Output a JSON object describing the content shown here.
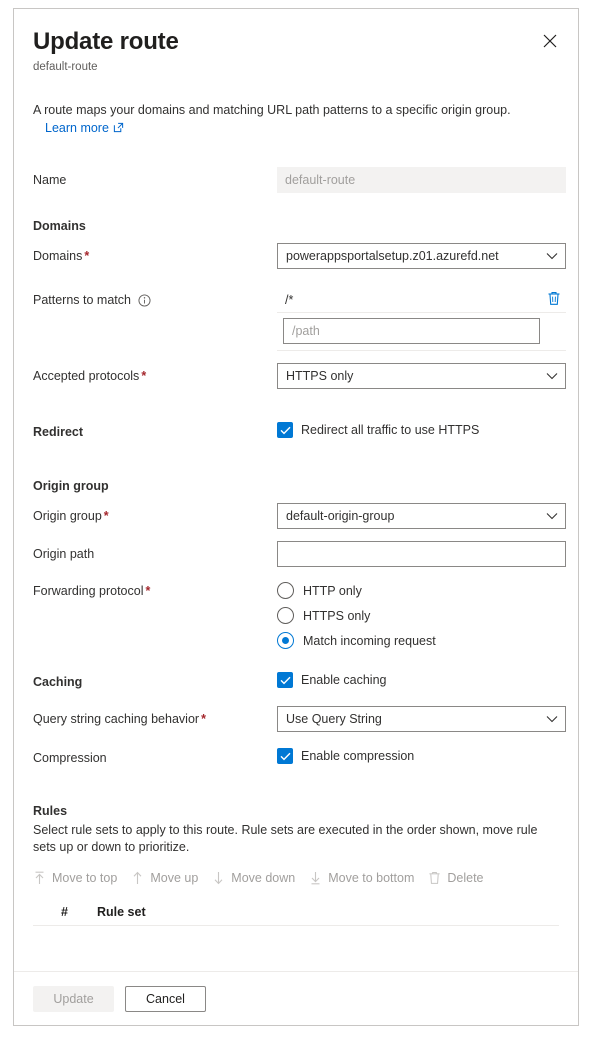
{
  "panel": {
    "title": "Update route",
    "subtitle": "default-route",
    "close_icon": "close-icon",
    "intro": "A route maps your domains and matching URL path patterns to a specific origin group.",
    "learn_more": "Learn more",
    "learn_more_icon": "external-link-icon"
  },
  "fields": {
    "name_label": "Name",
    "name_value": "default-route",
    "domains_section": "Domains",
    "domains_label": "Domains",
    "domains_value": "powerappsportalsetup.z01.azurefd.net",
    "patterns_label": "Patterns to match",
    "patterns_info_icon": "info-icon",
    "patterns_value": "/*",
    "patterns_delete_icon": "trash-icon",
    "patterns_placeholder": "/path",
    "patterns_input_value": "",
    "accepted_protocols_label": "Accepted protocols",
    "accepted_protocols_value": "HTTPS only",
    "redirect_label": "Redirect",
    "redirect_checkbox_label": "Redirect all traffic to use HTTPS",
    "redirect_checked": true,
    "origin_group_section": "Origin group",
    "origin_group_label": "Origin group",
    "origin_group_value": "default-origin-group",
    "origin_path_label": "Origin path",
    "origin_path_value": "",
    "forwarding_protocol_label": "Forwarding protocol",
    "forwarding_options": [
      {
        "label": "HTTP only",
        "selected": false
      },
      {
        "label": "HTTPS only",
        "selected": false
      },
      {
        "label": "Match incoming request",
        "selected": true
      }
    ],
    "caching_label": "Caching",
    "caching_checkbox_label": "Enable caching",
    "caching_checked": true,
    "query_string_label": "Query string caching behavior",
    "query_string_value": "Use Query String",
    "compression_label": "Compression",
    "compression_checkbox_label": "Enable compression",
    "compression_checked": true
  },
  "rules": {
    "heading": "Rules",
    "description": "Select rule sets to apply to this route. Rule sets are executed in the order shown, move rule sets up or down to prioritize.",
    "commands": [
      {
        "label": "Move to top",
        "icon": "move-to-top-icon",
        "disabled": true
      },
      {
        "label": "Move up",
        "icon": "arrow-up-icon",
        "disabled": true
      },
      {
        "label": "Move down",
        "icon": "arrow-down-icon",
        "disabled": true
      },
      {
        "label": "Move to bottom",
        "icon": "move-to-bottom-icon",
        "disabled": true
      },
      {
        "label": "Delete",
        "icon": "trash-icon",
        "disabled": true
      }
    ],
    "columns": [
      "#",
      "Rule set"
    ],
    "rows": []
  },
  "footer": {
    "update_label": "Update",
    "update_disabled": true,
    "cancel_label": "Cancel"
  },
  "colors": {
    "accent": "#0078d4",
    "required": "#a4262c",
    "link": "#0066cc",
    "disabled_text": "#a19f9d",
    "border": "#8a8886",
    "panel_border": "#c8c6c4"
  }
}
